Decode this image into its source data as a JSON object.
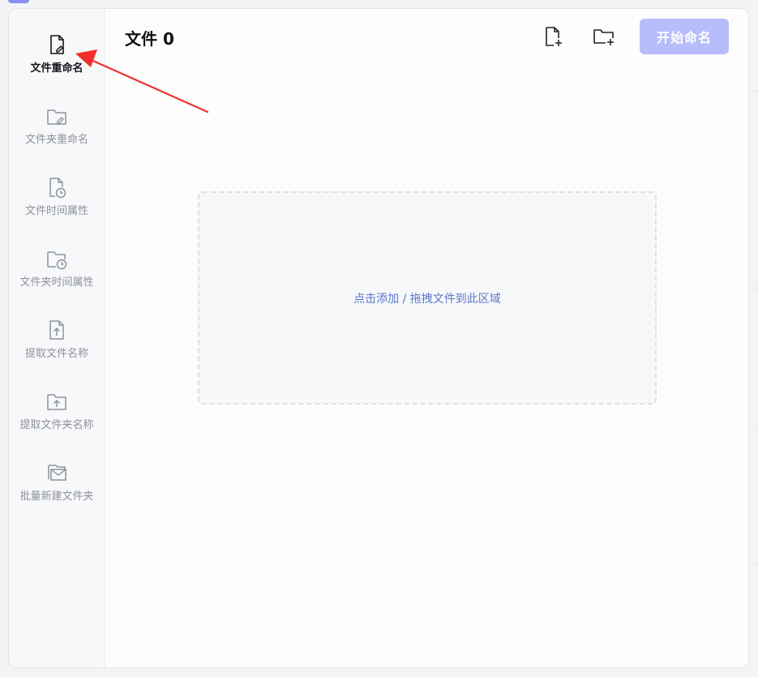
{
  "sidebar": {
    "items": [
      {
        "label": "文件重命名",
        "icon": "file-edit-icon",
        "active": true
      },
      {
        "label": "文件夹重命名",
        "icon": "folder-edit-icon",
        "active": false
      },
      {
        "label": "文件时间属性",
        "icon": "file-clock-icon",
        "active": false
      },
      {
        "label": "文件夹时间属性",
        "icon": "folder-clock-icon",
        "active": false
      },
      {
        "label": "提取文件名称",
        "icon": "file-upload-icon",
        "active": false
      },
      {
        "label": "提取文件夹名称",
        "icon": "folder-upload-icon",
        "active": false
      },
      {
        "label": "批量新建文件夹",
        "icon": "folders-stack-icon",
        "active": false
      }
    ]
  },
  "main": {
    "title": "文件 0",
    "toolbar": {
      "add_file_icon": "file-plus-icon",
      "add_folder_icon": "folder-plus-icon",
      "start_label": "开始命名"
    },
    "drop_zone": {
      "text": "点击添加 / 拖拽文件到此区域"
    }
  },
  "colors": {
    "accent_button": "#b7bdfb",
    "drop_text": "#5b76c9",
    "annotation_arrow": "#f0312a"
  }
}
